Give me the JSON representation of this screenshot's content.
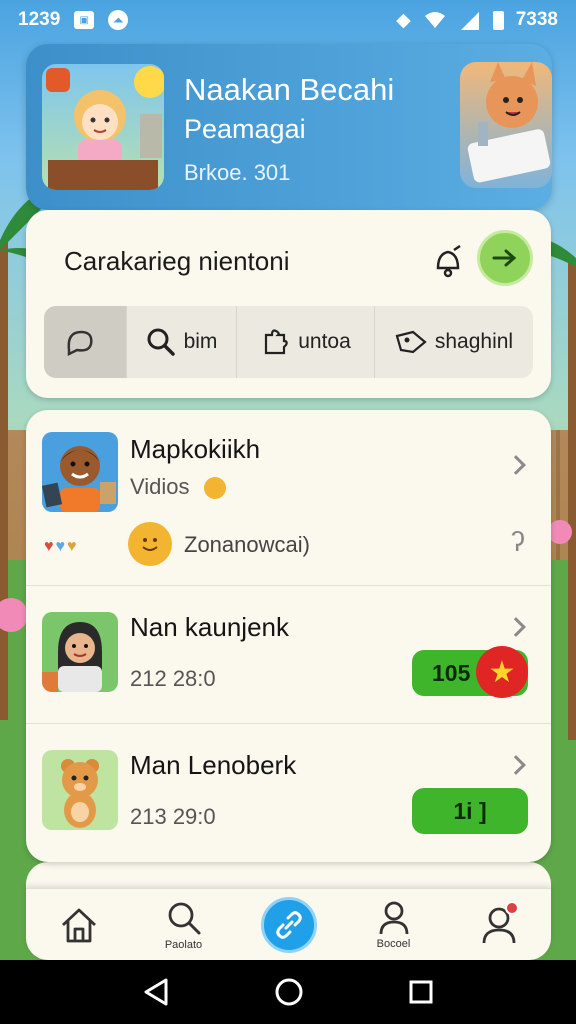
{
  "status_bar": {
    "time": "1239",
    "battery_text": "7338",
    "icons": [
      "notification-box-icon",
      "notification-circle-icon",
      "data-icon",
      "wifi-icon",
      "signal-icon",
      "battery-icon"
    ]
  },
  "header": {
    "title": "Naakan Becahi",
    "subtitle": "Peamagai",
    "meta": "Brkoe. 301"
  },
  "search": {
    "title": "Carakarieg nientoni",
    "tabs": [
      {
        "label": "",
        "icon": "chat-bubble-icon",
        "active": true
      },
      {
        "label": "bim",
        "icon": "search-icon",
        "active": false
      },
      {
        "label": "untoa",
        "icon": "puzzle-icon",
        "active": false
      },
      {
        "label": "shaghinl",
        "icon": "tag-icon",
        "active": false
      }
    ]
  },
  "list": {
    "items": [
      {
        "name": "Mapkokiikh",
        "sub": "Vidios",
        "reaction_text": "Zonanowcai)"
      },
      {
        "name": "Nan kaunjenk",
        "sub": "212  28:0",
        "pill": "105"
      },
      {
        "name": "Man Lenoberk",
        "sub": "213  29:0",
        "pill": "1i ]"
      }
    ]
  },
  "bottom_nav": {
    "items": [
      {
        "label": "",
        "icon": "home-icon"
      },
      {
        "label": "Paolato",
        "icon": "search-icon"
      },
      {
        "label": "",
        "icon": "link-icon"
      },
      {
        "label": "Bocoel",
        "icon": "person-icon"
      },
      {
        "label": "",
        "icon": "profile-icon"
      }
    ]
  },
  "colors": {
    "accent_blue": "#1fa0e8",
    "accent_green": "#3fb52c",
    "card_bg": "#fbf8ee",
    "badge_red": "#e02525"
  }
}
